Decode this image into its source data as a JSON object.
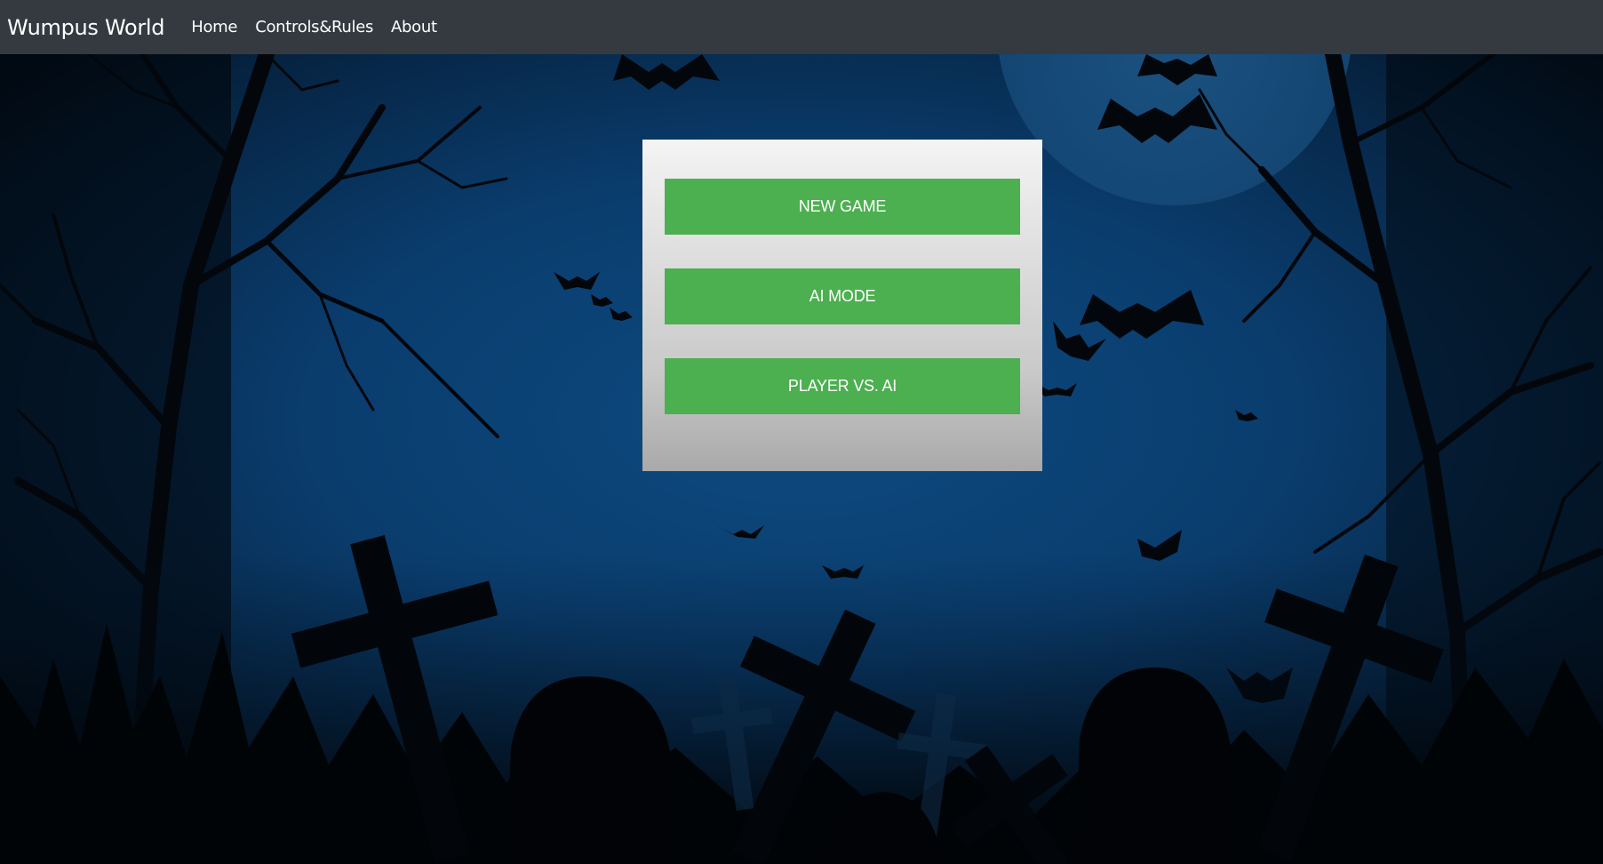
{
  "navbar": {
    "brand": "Wumpus World",
    "links": [
      "Home",
      "Controls&Rules",
      "About"
    ]
  },
  "menu": {
    "buttons": [
      "NEW GAME",
      "AI MODE",
      "PLAYER VS. AI"
    ]
  },
  "colors": {
    "navbar_bg": "#343a40",
    "button_green": "#4caf50",
    "night_sky": "#0a3d6e"
  },
  "background": {
    "scene": "haunted graveyard at night with bats, moon, bare trees and crosses",
    "icons": [
      "moon-icon",
      "bat-icon",
      "tree-icon",
      "cross-icon",
      "tombstone-icon"
    ]
  }
}
